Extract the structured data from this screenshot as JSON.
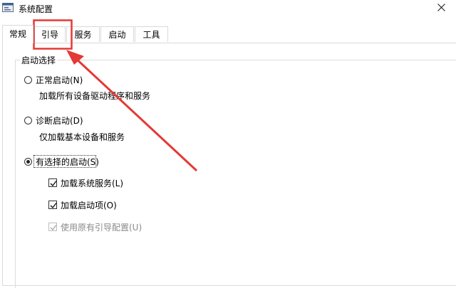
{
  "window": {
    "title": "系统配置",
    "icons": {
      "app": "msconfig-window-icon",
      "close": "close-icon"
    }
  },
  "tabs": [
    {
      "label": "常规",
      "active": true
    },
    {
      "label": "引导",
      "active": false,
      "highlighted": true
    },
    {
      "label": "服务",
      "active": false
    },
    {
      "label": "启动",
      "active": false
    },
    {
      "label": "工具",
      "active": false
    }
  ],
  "startup_selection": {
    "group_label": "启动选择",
    "options": [
      {
        "label": "正常启动(N)",
        "description": "加载所有设备驱动程序和服务",
        "checked": false
      },
      {
        "label": "诊断启动(D)",
        "description": "仅加载基本设备和服务",
        "checked": false
      },
      {
        "label": "有选择的启动(S)",
        "checked": true
      }
    ],
    "sub_options": [
      {
        "label": "加载系统服务(L)",
        "checked": true,
        "enabled": true
      },
      {
        "label": "加载启动项(O)",
        "checked": true,
        "enabled": true
      },
      {
        "label": "使用原有引导配置(U)",
        "checked": true,
        "enabled": false
      }
    ]
  },
  "annotation": {
    "highlight_color": "#e53935",
    "arrow_color": "#e53935"
  }
}
